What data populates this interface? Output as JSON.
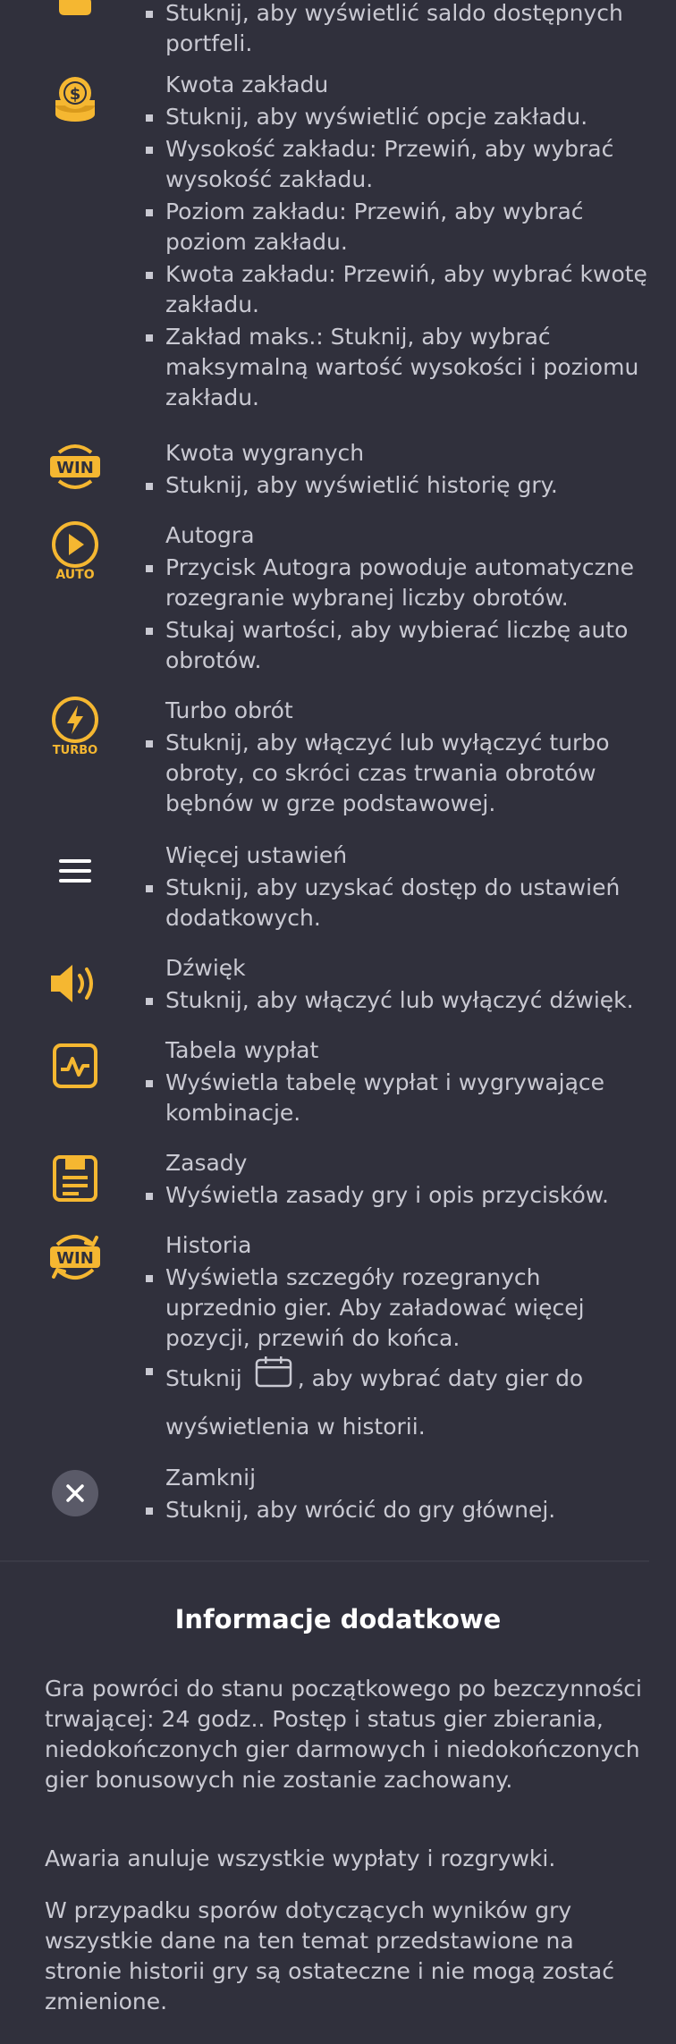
{
  "items": [
    {
      "id": "wallet",
      "title": "",
      "bullets": [
        "Stuknij, aby wyświetlić saldo dostępnych portfeli."
      ]
    },
    {
      "id": "bet-amount",
      "icon": "coin-stack-icon",
      "title": "Kwota zakładu",
      "bullets": [
        "Stuknij, aby wyświetlić opcje zakładu.",
        "Wysokość zakładu: Przewiń, aby wybrać wysokość zakładu.",
        "Poziom zakładu: Przewiń, aby wybrać poziom zakładu.",
        "Kwota zakładu: Przewiń, aby wybrać kwotę zakładu.",
        "Zakład maks.: Stuknij, aby wybrać maksymalną wartość wysokości i poziomu zakładu."
      ]
    },
    {
      "id": "win-amount",
      "icon": "win-badge-icon",
      "title": "Kwota wygranych",
      "bullets": [
        "Stuknij, aby wyświetlić historię gry."
      ]
    },
    {
      "id": "autoplay",
      "icon": "autoplay-icon",
      "icon_text": "AUTO",
      "title": "Autogra",
      "bullets": [
        "Przycisk Autogra powoduje automatyczne rozegranie wybranej liczby obrotów.",
        "Stukaj wartości, aby wybierać liczbę auto obrotów."
      ]
    },
    {
      "id": "turbo",
      "icon": "turbo-icon",
      "icon_text": "TURBO",
      "title": "Turbo obrót",
      "bullets": [
        "Stuknij, aby włączyć lub wyłączyć turbo obroty, co skróci czas trwania obrotów bębnów w grze podstawowej."
      ]
    },
    {
      "id": "more-settings",
      "icon": "hamburger-menu-icon",
      "title": "Więcej ustawień",
      "bullets": [
        "Stuknij, aby uzyskać dostęp do ustawień dodatkowych."
      ]
    },
    {
      "id": "sound",
      "icon": "speaker-icon",
      "title": "Dźwięk",
      "bullets": [
        "Stuknij, aby włączyć lub wyłączyć dźwięk."
      ]
    },
    {
      "id": "paytable",
      "icon": "paytable-icon",
      "title": "Tabela wypłat",
      "bullets": [
        "Wyświetla tabelę wypłat i wygrywające kombinacje."
      ]
    },
    {
      "id": "rules",
      "icon": "rules-document-icon",
      "title": "Zasady",
      "bullets": [
        "Wyświetla zasady gry i opis przycisków."
      ]
    },
    {
      "id": "history",
      "icon": "history-win-icon",
      "title": "Historia",
      "bullets": [
        "Wyświetla szczegóły rozegranych uprzednio gier. Aby załadować więcej pozycji, przewiń do końca."
      ],
      "calendar_before": "Stuknij",
      "calendar_after": ", aby wybrać daty gier do wyświetlenia w historii."
    },
    {
      "id": "close",
      "icon": "close-icon",
      "title": "Zamknij",
      "bullets": [
        "Stuknij, aby wrócić do gry głównej."
      ]
    }
  ],
  "additional": {
    "title": "Informacje dodatkowe",
    "paragraphs": [
      "Gra powróci do stanu początkowego po bezczynności trwającej: 24 godz.. Postęp i status gier zbierania, niedokończonych gier darmowych i niedokończonych gier bonusowych nie zostanie zachowany.",
      "Awaria anuluje wszystkie wypłaty i rozgrywki.",
      "W przypadku sporów dotyczących wyników gry wszystkie dane na ten temat przedstawione na stronie historii gry są ostateczne i nie mogą zostać zmienione."
    ]
  },
  "colors": {
    "background": "#30303c",
    "accent": "#f5b731",
    "text": "#c9c9d2",
    "title": "#ffffff"
  }
}
